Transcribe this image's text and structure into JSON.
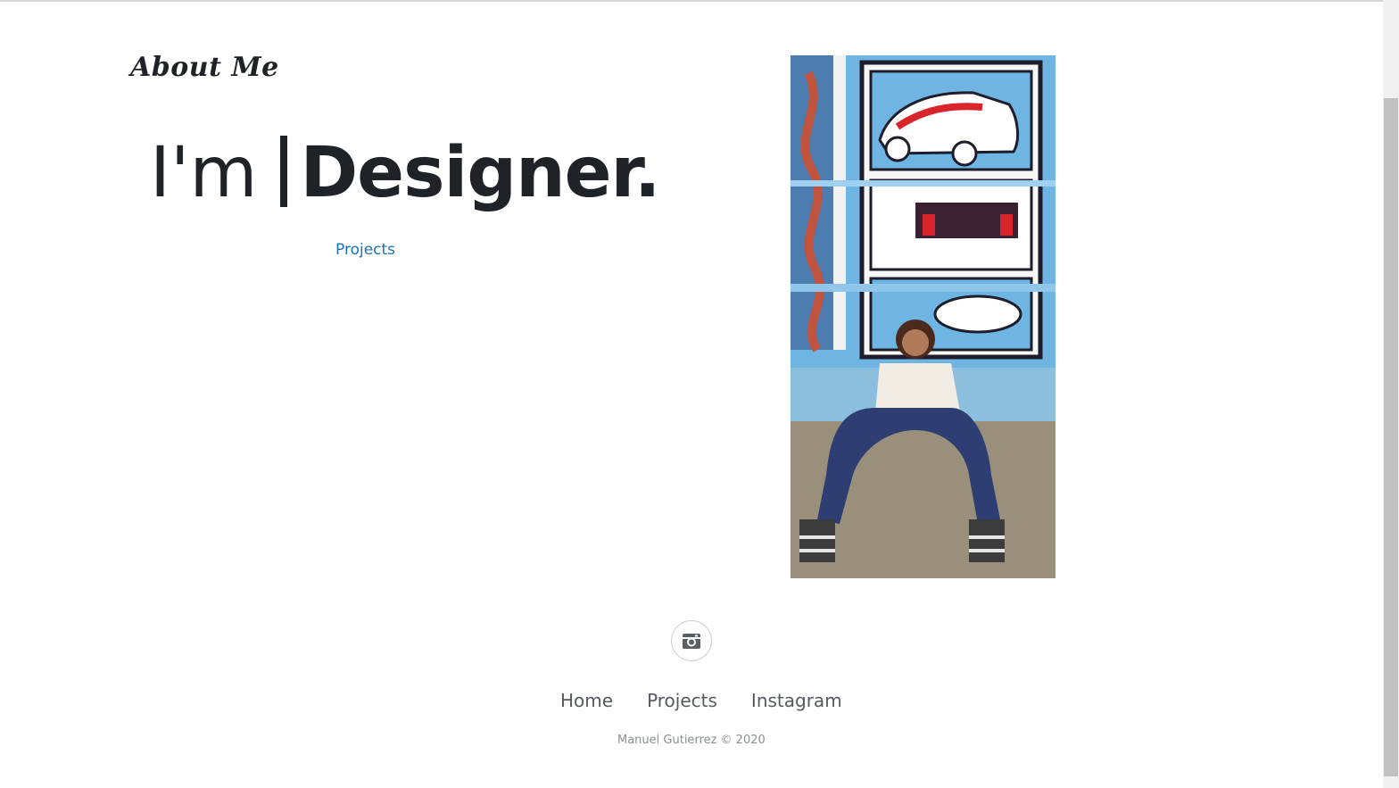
{
  "page": {
    "section_title": "About Me",
    "headline_prefix": "I'm",
    "headline_role": "Designer.",
    "cta_link": "Projects"
  },
  "photo": {
    "icon": "portrait-photo"
  },
  "footer": {
    "social_icon": "instagram-icon",
    "nav": [
      "Home",
      "Projects",
      "Instagram"
    ],
    "copyright": "Manuel Gutierrez © 2020"
  },
  "colors": {
    "text": "#1f2327",
    "link": "#1a73b0",
    "footer_text": "#555a60",
    "muted": "#8a8f95"
  }
}
